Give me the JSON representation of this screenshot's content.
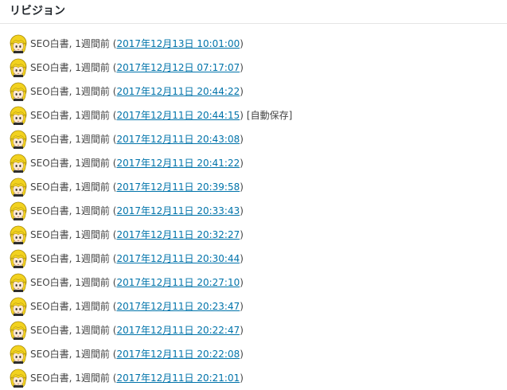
{
  "panel": {
    "title": "リビジョン"
  },
  "revisions": [
    {
      "author": "SEO白書",
      "ago": "1週間前",
      "date": "2017年12月13日 10:01:00",
      "note": ""
    },
    {
      "author": "SEO白書",
      "ago": "1週間前",
      "date": "2017年12月12日 07:17:07",
      "note": ""
    },
    {
      "author": "SEO白書",
      "ago": "1週間前",
      "date": "2017年12月11日 20:44:22",
      "note": ""
    },
    {
      "author": "SEO白書",
      "ago": "1週間前",
      "date": "2017年12月11日 20:44:15",
      "note": "[自動保存]"
    },
    {
      "author": "SEO白書",
      "ago": "1週間前",
      "date": "2017年12月11日 20:43:08",
      "note": ""
    },
    {
      "author": "SEO白書",
      "ago": "1週間前",
      "date": "2017年12月11日 20:41:22",
      "note": ""
    },
    {
      "author": "SEO白書",
      "ago": "1週間前",
      "date": "2017年12月11日 20:39:58",
      "note": ""
    },
    {
      "author": "SEO白書",
      "ago": "1週間前",
      "date": "2017年12月11日 20:33:43",
      "note": ""
    },
    {
      "author": "SEO白書",
      "ago": "1週間前",
      "date": "2017年12月11日 20:32:27",
      "note": ""
    },
    {
      "author": "SEO白書",
      "ago": "1週間前",
      "date": "2017年12月11日 20:30:44",
      "note": ""
    },
    {
      "author": "SEO白書",
      "ago": "1週間前",
      "date": "2017年12月11日 20:27:10",
      "note": ""
    },
    {
      "author": "SEO白書",
      "ago": "1週間前",
      "date": "2017年12月11日 20:23:47",
      "note": ""
    },
    {
      "author": "SEO白書",
      "ago": "1週間前",
      "date": "2017年12月11日 20:22:47",
      "note": ""
    },
    {
      "author": "SEO白書",
      "ago": "1週間前",
      "date": "2017年12月11日 20:22:08",
      "note": ""
    },
    {
      "author": "SEO白書",
      "ago": "1週間前",
      "date": "2017年12月11日 20:21:01",
      "note": ""
    }
  ],
  "colors": {
    "link": "#0073aa",
    "text": "#444444",
    "title": "#23282d",
    "avatar_hair": "#f2d21f"
  },
  "icons": {
    "avatar": "user-avatar-icon"
  }
}
